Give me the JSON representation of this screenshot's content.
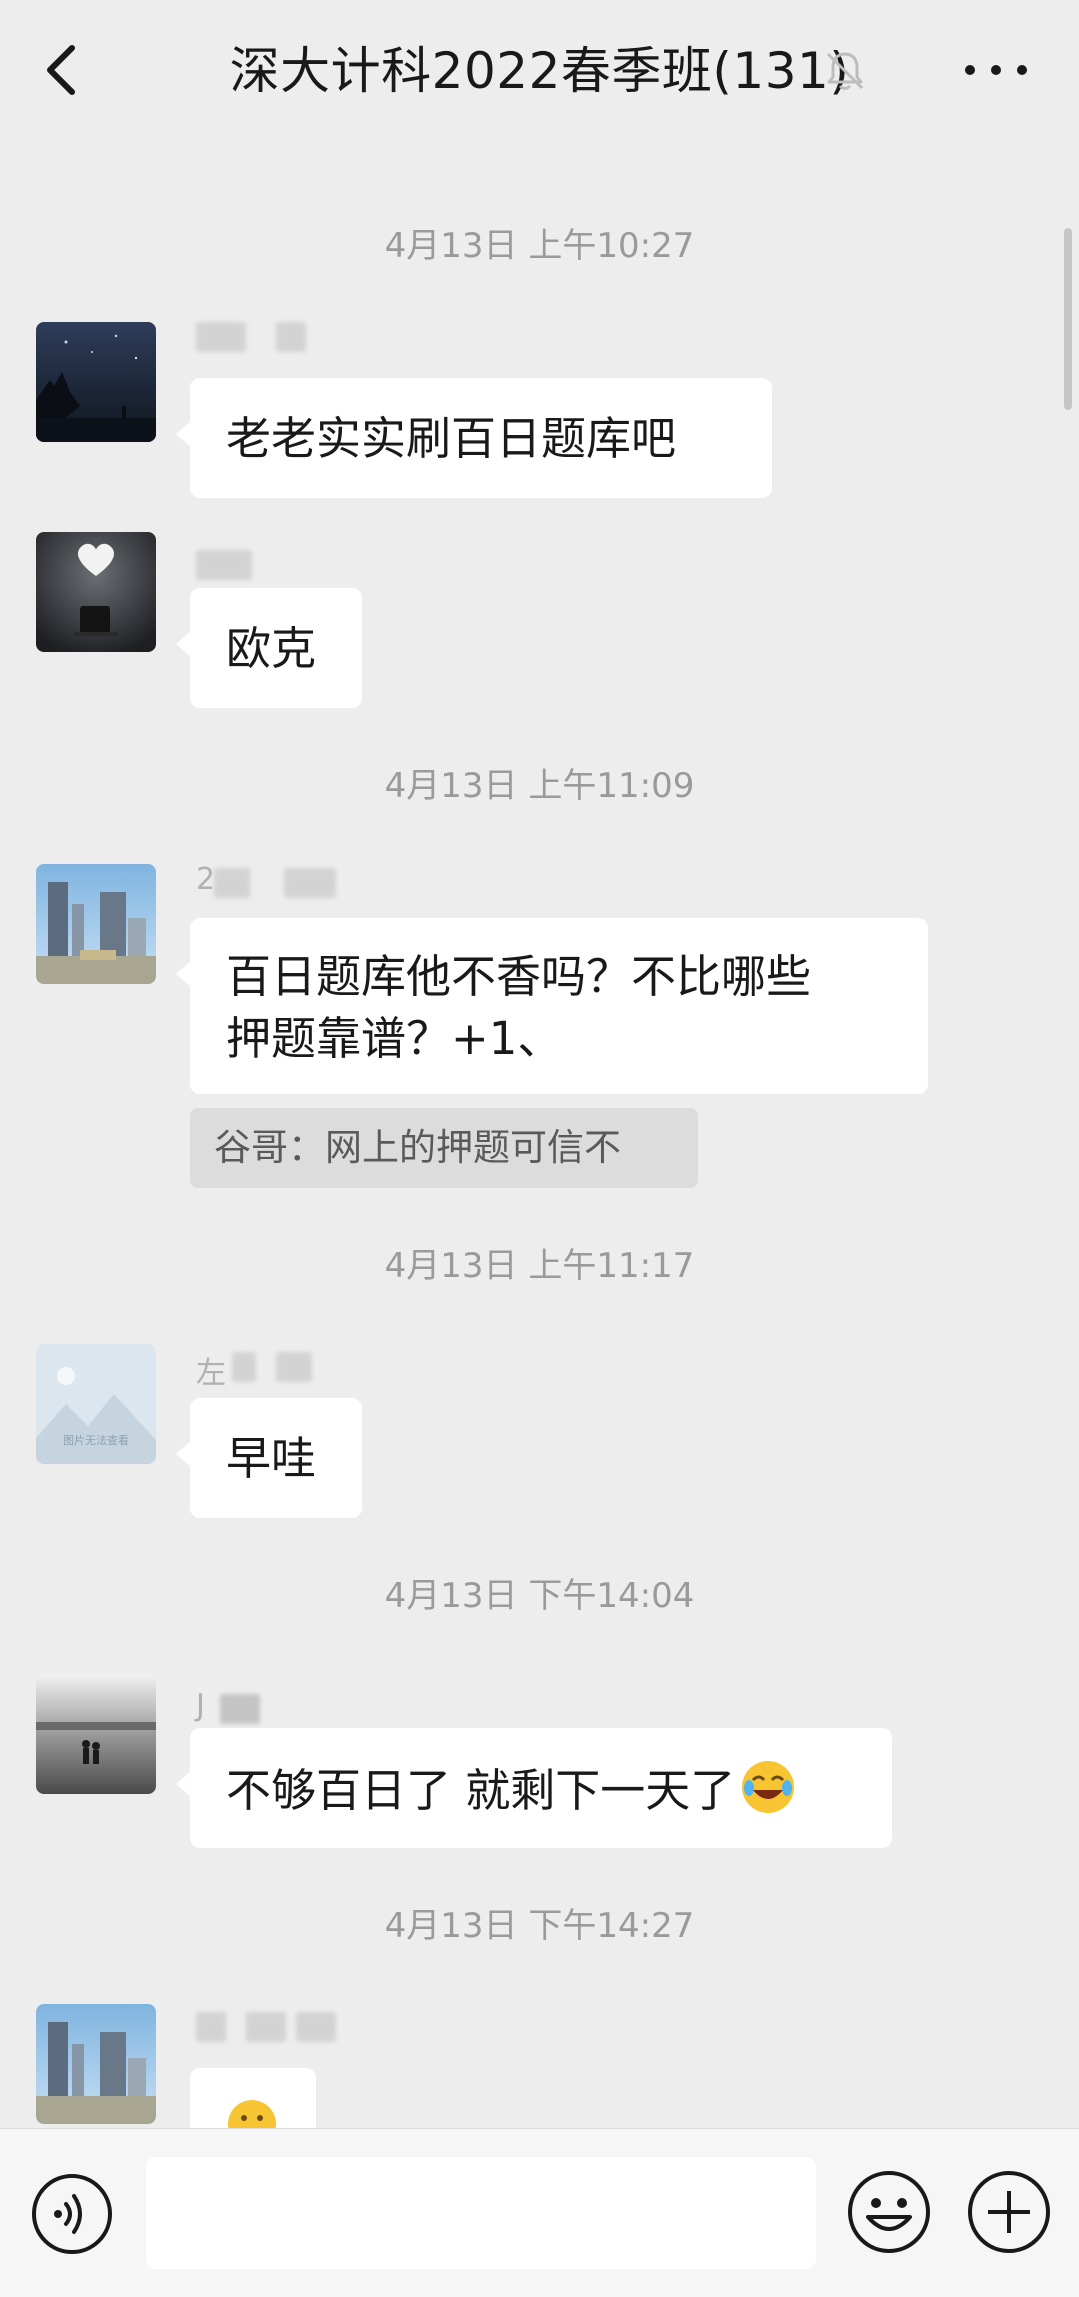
{
  "header": {
    "title": "深大计科2022春季班(131)"
  },
  "timestamps": [
    "4月13日 上午10:27",
    "4月13日 上午11:09",
    "4月13日 上午11:17",
    "4月13日 下午14:04",
    "4月13日 下午14:27"
  ],
  "messages": [
    {
      "name_visible": "",
      "text": "老老实实刷百日题库吧"
    },
    {
      "name_visible": "",
      "text": "欧克"
    },
    {
      "name_visible": "2",
      "line1": "百日题库他不香吗？不比哪些",
      "line2": "押题靠谱？+1、",
      "quote": "谷哥：网上的押题可信不"
    },
    {
      "name_visible": "左",
      "text": "早哇",
      "avatar_caption": "图片无法查看"
    },
    {
      "name_visible": "J",
      "text": "不够百日了 就剩下一天了"
    },
    {
      "name_visible": "",
      "text": ""
    }
  ],
  "colors": {
    "background": "#ededed",
    "bubble": "#ffffff",
    "timestamp": "#9a9a9a",
    "quote_bg": "#dcdcdc"
  },
  "icons": [
    "back-arrow-icon",
    "mute-bell-icon",
    "more-icon",
    "voice-icon",
    "emoji-icon",
    "plus-icon"
  ]
}
